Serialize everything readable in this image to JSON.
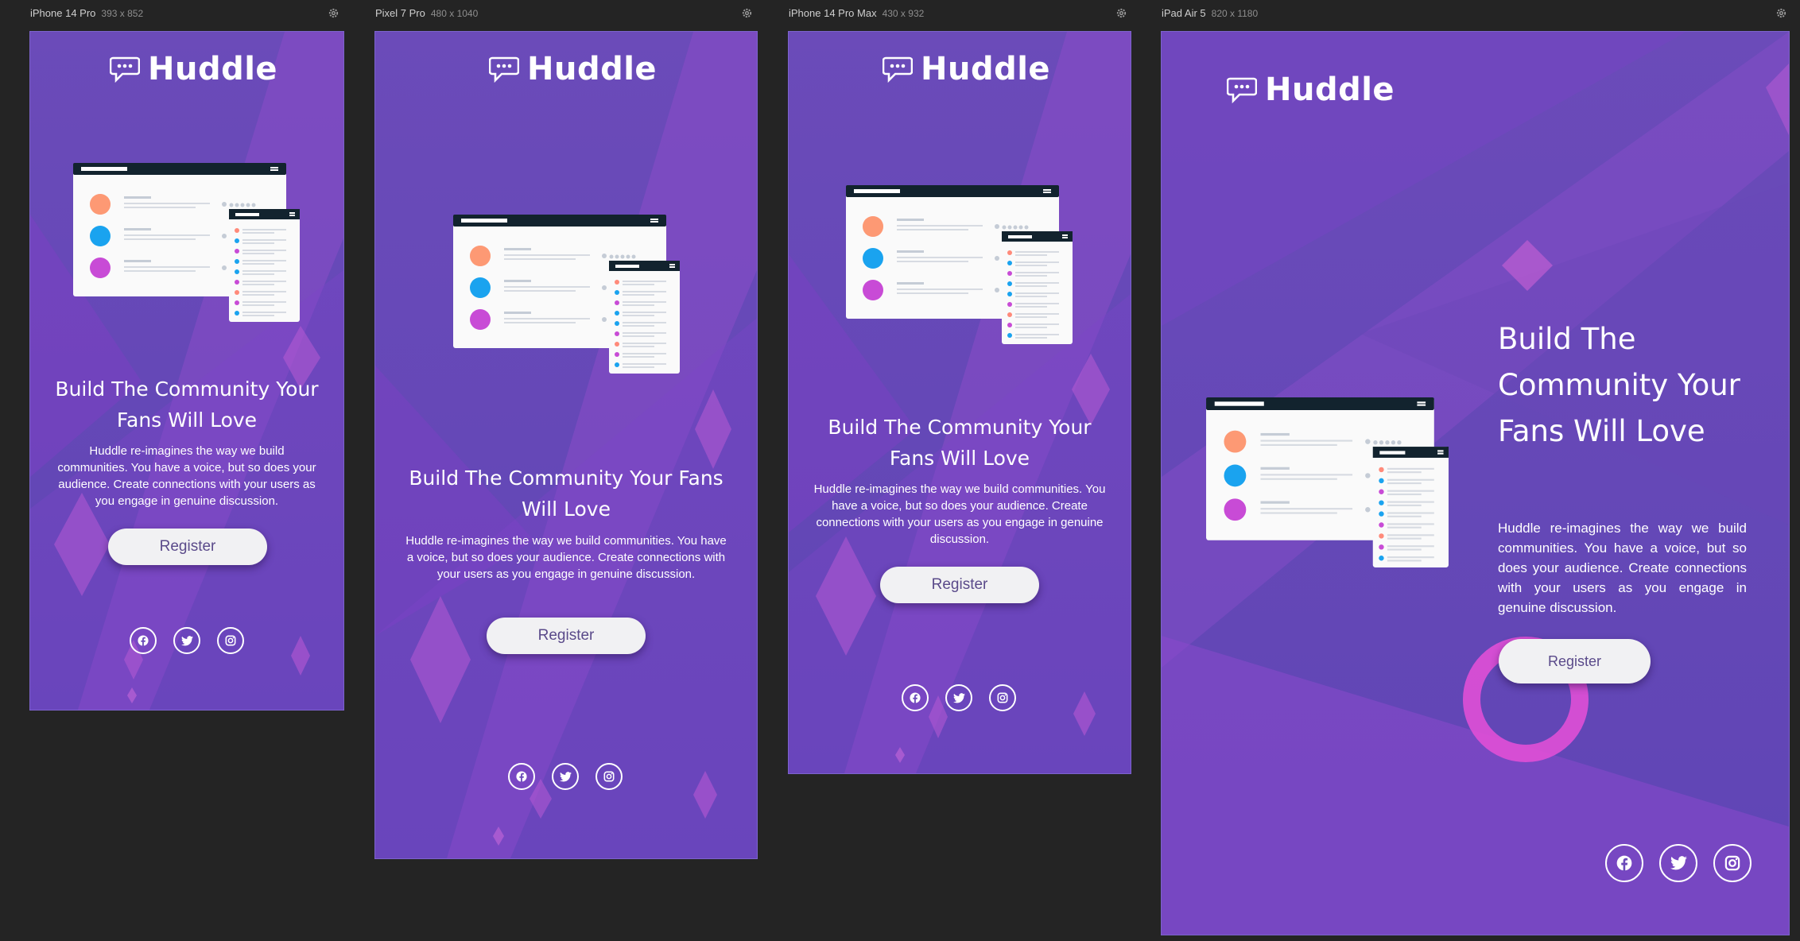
{
  "devices": [
    {
      "name": "iPhone 14 Pro",
      "dims": "393 x 852"
    },
    {
      "name": "Pixel 7 Pro",
      "dims": "480 x 1040"
    },
    {
      "name": "iPhone 14 Pro Max",
      "dims": "430 x 932"
    },
    {
      "name": "iPad Air 5",
      "dims": "820 x 1180"
    }
  ],
  "brand": {
    "name": "Huddle"
  },
  "hero": {
    "title": "Build The Community Your Fans Will Love",
    "description": "Huddle re-imagines the way we build communities. You have a voice, but so does your audience. Create connections with your users as you engage in genuine discussion.",
    "cta": "Register"
  },
  "socials": [
    {
      "name": "facebook",
      "icon": "facebook-icon"
    },
    {
      "name": "twitter",
      "icon": "twitter-icon"
    },
    {
      "name": "instagram",
      "icon": "instagram-icon"
    }
  ],
  "colors": {
    "background": "#242424",
    "screen_purple": "#6b4bb9",
    "shape_violet": "#9b4fd0",
    "button_bg": "#f1f1f3",
    "button_text": "#5a4a8a",
    "mock_header": "#12232e"
  }
}
